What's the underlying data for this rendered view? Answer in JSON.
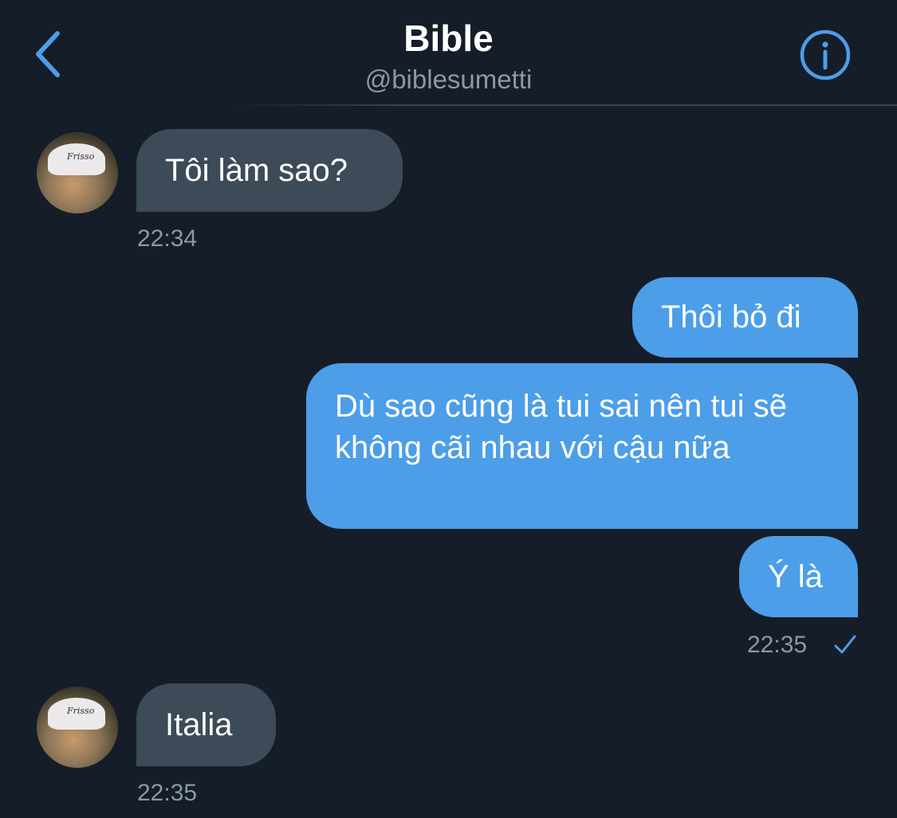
{
  "header": {
    "title": "Bible",
    "handle": "@biblesumetti",
    "accent_color": "#4c9ee8",
    "back_icon": "chevron-left-icon",
    "info_icon": "info-icon"
  },
  "messages": [
    {
      "direction": "incoming",
      "text": "Tôi làm sao?",
      "time": "22:34"
    },
    {
      "direction": "outgoing",
      "text": "Thôi bỏ đi"
    },
    {
      "direction": "outgoing",
      "text": "Dù sao cũng là tui sai nên tui sẽ không cãi nhau với cậu nữa"
    },
    {
      "direction": "outgoing",
      "text": "Ý là",
      "time": "22:35",
      "status_icon": "check-icon"
    },
    {
      "direction": "incoming",
      "text": "Italia",
      "time": "22:35"
    }
  ],
  "avatar_hat_text": "Frisso",
  "colors": {
    "background": "#151d29",
    "incoming_bubble": "#3d4a57",
    "outgoing_bubble": "#4c9ee8",
    "muted_text": "#8b98a5"
  }
}
